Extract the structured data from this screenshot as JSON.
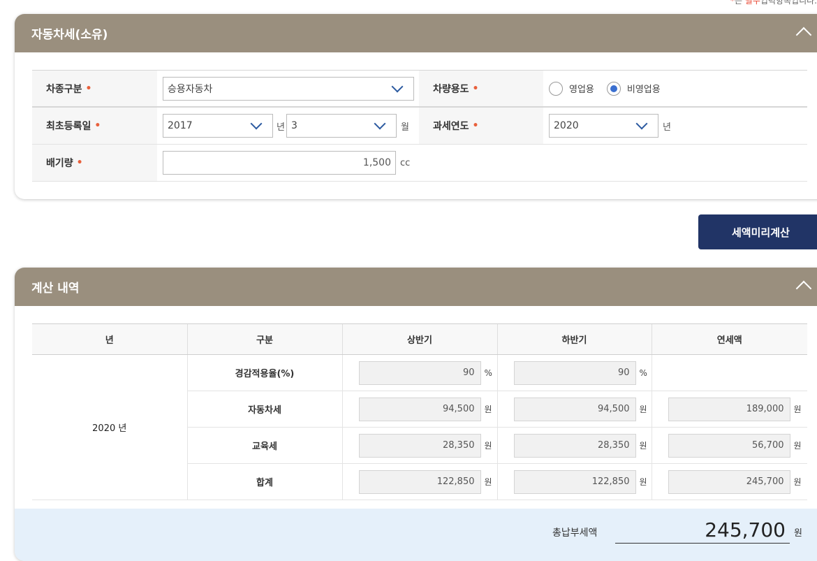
{
  "notice": {
    "star": "*",
    "prefix": "는 ",
    "required": "필수",
    "suffix": "입력항목입니다."
  },
  "section_vehicle": {
    "title": "자동차세(소유)",
    "fields": {
      "car_type": {
        "label": "차종구분",
        "value": "승용자동차"
      },
      "usage": {
        "label": "차량용도",
        "options": [
          {
            "label": "영업용",
            "checked": false
          },
          {
            "label": "비영업용",
            "checked": true
          }
        ]
      },
      "first_reg": {
        "label": "최초등록일",
        "year": "2017",
        "year_unit": "년",
        "month": "3",
        "month_unit": "월"
      },
      "tax_year": {
        "label": "과세연도",
        "value": "2020",
        "unit": "년"
      },
      "displacement": {
        "label": "배기량",
        "value": "1,500",
        "unit": "cc"
      }
    },
    "required_mark": "•"
  },
  "calc_button": {
    "label": "세액미리계산"
  },
  "section_result": {
    "title": "계산 내역",
    "headers": [
      "년",
      "구분",
      "상반기",
      "하반기",
      "연세액"
    ],
    "year": "2020 년",
    "rows": [
      {
        "label": "경감적용율(%)",
        "first": "90",
        "first_unit": "%",
        "second": "90",
        "second_unit": "%",
        "annual": "",
        "annual_unit": ""
      },
      {
        "label": "자동차세",
        "first": "94,500",
        "first_unit": "원",
        "second": "94,500",
        "second_unit": "원",
        "annual": "189,000",
        "annual_unit": "원"
      },
      {
        "label": "교육세",
        "first": "28,350",
        "first_unit": "원",
        "second": "28,350",
        "second_unit": "원",
        "annual": "56,700",
        "annual_unit": "원"
      },
      {
        "label": "합계",
        "first": "122,850",
        "first_unit": "원",
        "second": "122,850",
        "second_unit": "원",
        "annual": "245,700",
        "annual_unit": "원"
      }
    ],
    "total": {
      "label": "총납부세액",
      "value": "245,700",
      "unit": "원"
    }
  },
  "colors": {
    "header": "#9a8f7e",
    "button": "#213466",
    "radio_checked": "#3a6fd0",
    "required": "#e8603c",
    "total_bg": "#e5f0fa"
  }
}
